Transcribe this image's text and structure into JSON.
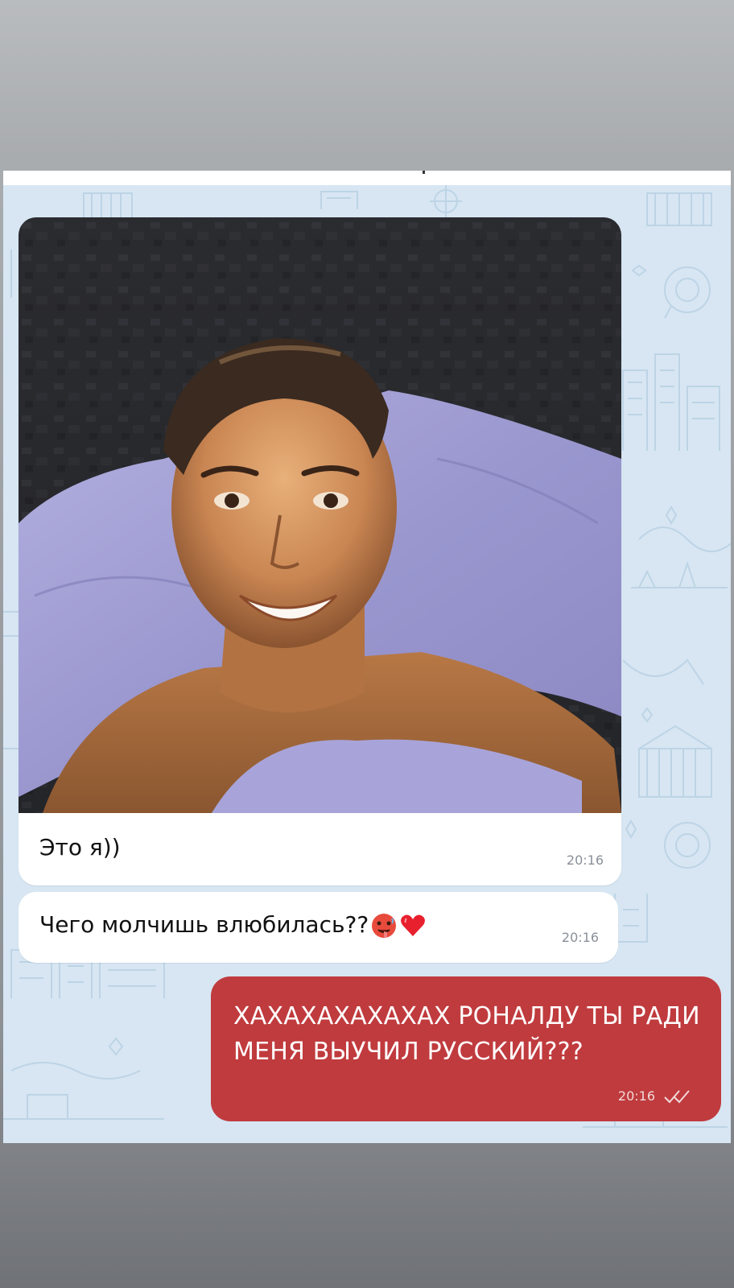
{
  "messages": [
    {
      "direction": "incoming",
      "type": "photo",
      "caption": "Это я))",
      "time": "20:16"
    },
    {
      "direction": "incoming",
      "type": "text",
      "text": "Чего молчишь влюбилась??",
      "emojis": [
        "hot-face-emoji",
        "red-heart-emoji"
      ],
      "time": "20:16"
    },
    {
      "direction": "outgoing",
      "type": "text",
      "text": "ХАХАХАХАХАХАХ РОНАЛДУ ТЫ РАДИ МЕНЯ ВЫУЧИЛ РУССКИЙ???",
      "time": "20:16",
      "status": "read"
    }
  ],
  "colors": {
    "chat_background": "#d7e6f2",
    "incoming_bubble": "#ffffff",
    "outgoing_bubble": "#c03b3e",
    "timestamp": "#8a9099"
  }
}
